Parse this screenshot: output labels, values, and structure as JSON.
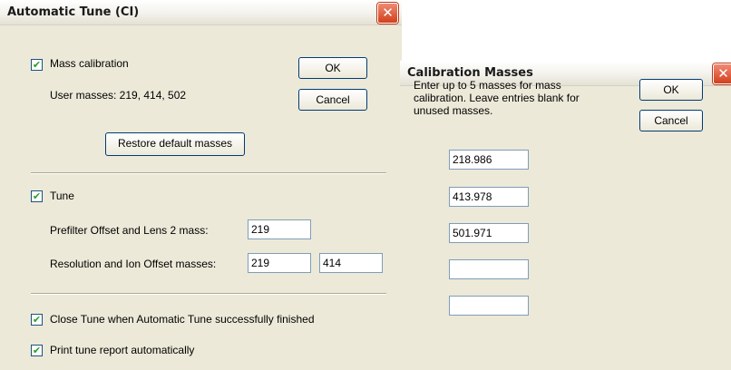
{
  "auto_tune": {
    "title": "Automatic Tune (CI)",
    "close_icon": "✕",
    "mass_calibration_label": "Mass calibration",
    "mass_calibration_checked": true,
    "user_masses_text": "User masses: 219, 414, 502",
    "ok_label": "OK",
    "cancel_label": "Cancel",
    "restore_label": "Restore default masses",
    "tune_label": "Tune",
    "tune_checked": true,
    "prefilter_label": "Prefilter Offset and Lens 2 mass:",
    "prefilter_value": "219",
    "resolution_label": "Resolution and Ion Offset masses:",
    "resolution_value_1": "219",
    "resolution_value_2": "414",
    "close_tune_label": "Close Tune when Automatic Tune successfully finished",
    "close_tune_checked": true,
    "print_report_label": "Print tune report automatically",
    "print_report_checked": true,
    "check_glyph": "✔"
  },
  "calibration_masses": {
    "title": "Calibration Masses",
    "close_icon": "✕",
    "instructions": [
      "Enter up to 5 masses for mass",
      "calibration. Leave entries blank for",
      "unused masses."
    ],
    "ok_label": "OK",
    "cancel_label": "Cancel",
    "masses": [
      "218.986",
      "413.978",
      "501.971",
      "",
      ""
    ]
  }
}
